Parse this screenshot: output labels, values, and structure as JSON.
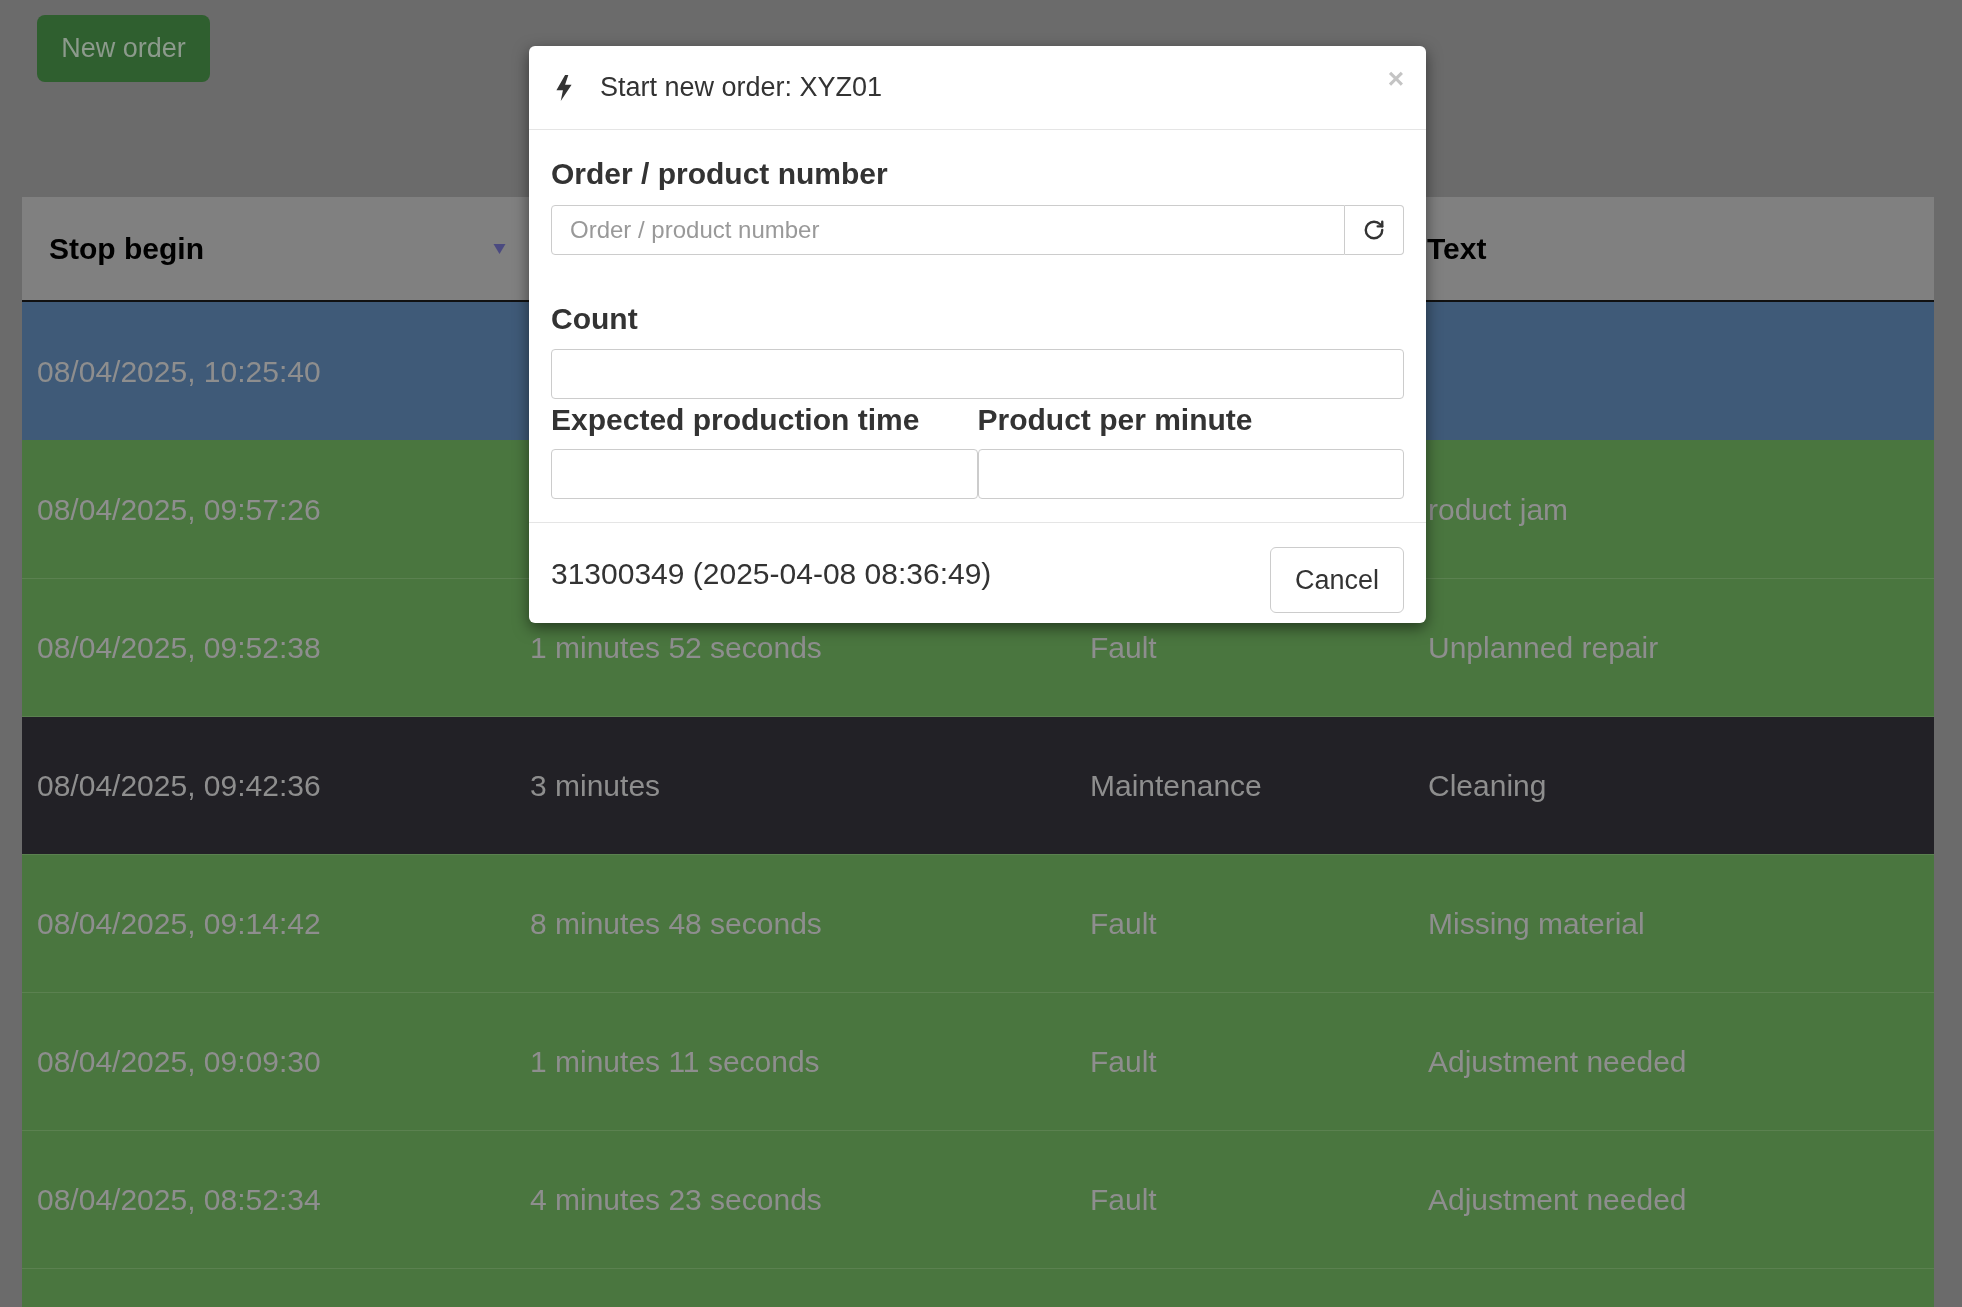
{
  "toolbar": {
    "new_order_button": "New order"
  },
  "table": {
    "columns": [
      {
        "label": "Stop begin",
        "sorted": true
      },
      {
        "label": "Text",
        "sorted": false
      }
    ],
    "rows": [
      {
        "color": "#3f5a78",
        "stop_begin": "08/04/2025, 10:25:40"
      },
      {
        "color": "#4a763f",
        "stop_begin": "08/04/2025, 09:57:26",
        "text": "roduct jam"
      },
      {
        "color": "#4a763f",
        "stop_begin": "08/04/2025, 09:52:38",
        "column_2": "1 minutes 52 seconds",
        "column_3": "Fault",
        "text": "Unplanned repair"
      },
      {
        "color": "#222126",
        "stop_begin": "08/04/2025, 09:42:36",
        "column_2": "3 minutes",
        "column_3": "Maintenance",
        "text": "Cleaning"
      },
      {
        "color": "#4a763f",
        "stop_begin": "08/04/2025, 09:14:42",
        "column_2": "8 minutes 48 seconds",
        "column_3": "Fault",
        "text": "Missing material"
      },
      {
        "color": "#4a763f",
        "stop_begin": "08/04/2025, 09:09:30",
        "column_2": "1 minutes 11 seconds",
        "column_3": "Fault",
        "text": "Adjustment needed"
      },
      {
        "color": "#4a763f",
        "stop_begin": "08/04/2025, 08:52:34",
        "column_2": "4 minutes 23 seconds",
        "column_3": "Fault",
        "text": "Adjustment needed"
      },
      {
        "color": "#4a763f"
      }
    ]
  },
  "dialog": {
    "title": "Start new order: XYZ01",
    "close": "×",
    "order_number": {
      "label": "Order / product number",
      "placeholder": "Order / product number"
    },
    "count": {
      "label": "Count"
    },
    "expected_production_time": {
      "label": "Expected production time"
    },
    "product_per_minute": {
      "label": "Product per minute"
    },
    "footer_info": "31300349 (2025-04-08 08:36:49)",
    "cancel_button": "Cancel"
  }
}
